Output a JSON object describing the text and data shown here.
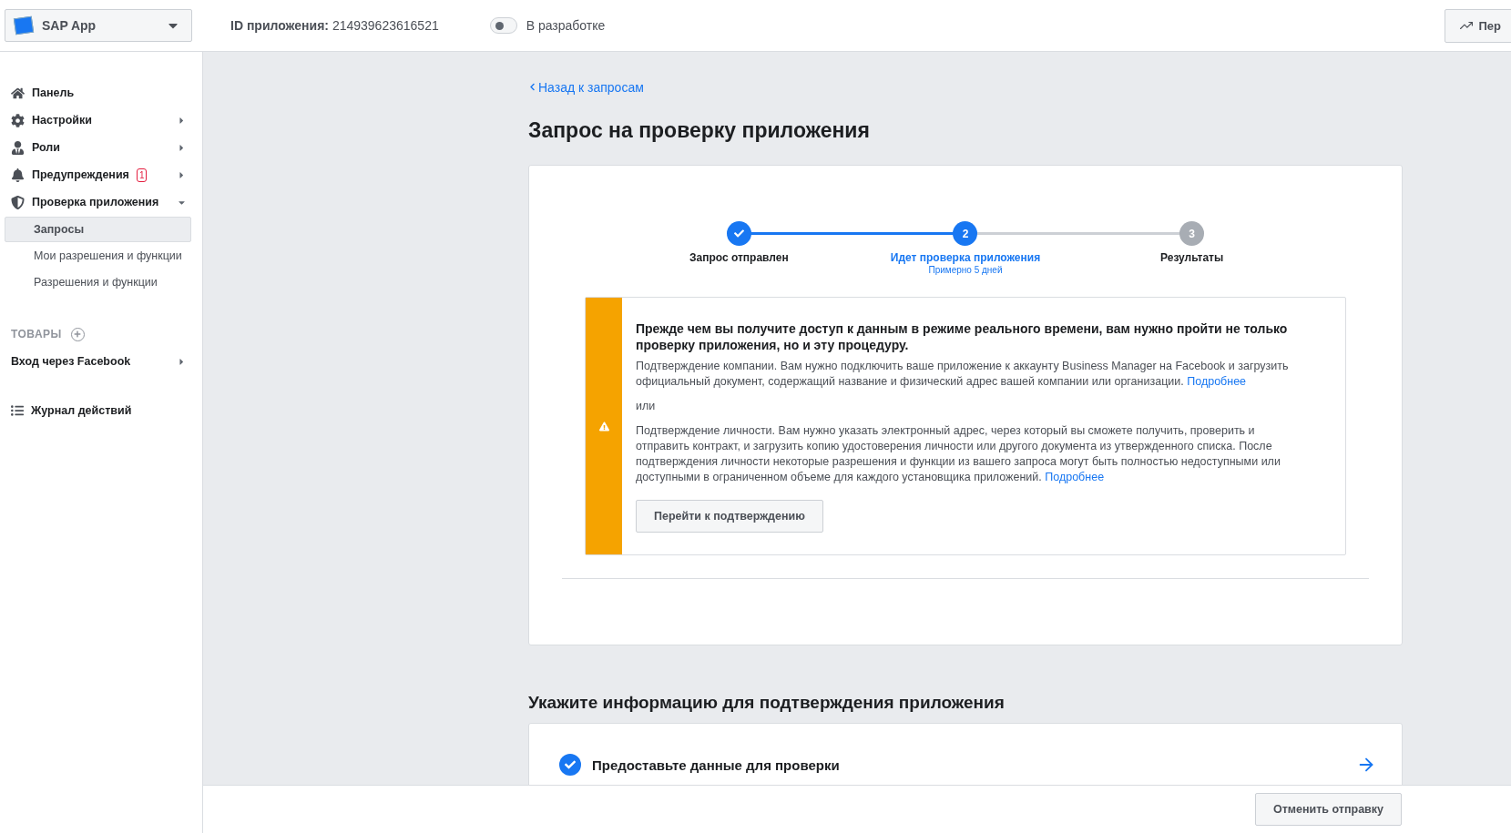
{
  "app_selector": {
    "name": "SAP App"
  },
  "header": {
    "app_id_label": "ID приложения:",
    "app_id": "214939623616521",
    "dev_mode": {
      "on": false,
      "label": "В разработке"
    },
    "right_button": "Пер"
  },
  "sidebar": {
    "items": [
      {
        "label": "Панель"
      },
      {
        "label": "Настройки",
        "expanded": false
      },
      {
        "label": "Роли",
        "expanded": false
      },
      {
        "label": "Предупреждения",
        "expanded": false,
        "badge": "1"
      },
      {
        "label": "Проверка приложения",
        "expanded": true,
        "children": [
          {
            "label": "Запросы",
            "selected": true
          },
          {
            "label": "Мои разрешения и функции",
            "selected": false
          },
          {
            "label": "Разрешения и функции",
            "selected": false
          }
        ]
      }
    ],
    "products_heading": "ТОВАРЫ",
    "products": [
      {
        "label": "Вход через Facebook"
      }
    ],
    "activity_log": "Журнал действий"
  },
  "back_link": "Назад к запросам",
  "title": "Запрос на проверку приложения",
  "steps": [
    {
      "label": "Запрос отправлен",
      "kind": "done"
    },
    {
      "label": "Идет проверка приложения",
      "number": "2",
      "sublabel": "Примерно 5 дней",
      "kind": "current"
    },
    {
      "label": "Результаты",
      "number": "3",
      "kind": "upcoming"
    }
  ],
  "warning": {
    "heading": "Прежде чем вы получите доступ к данным в режиме реального времени, вам нужно пройти не только проверку приложения, но и эту процедуру.",
    "paragraphs": [
      {
        "text": "Подтверждение компании. Вам нужно подключить ваше приложение к аккаунту Business Manager на Facebook и загрузить официальный документ, содержащий название и физический адрес вашей компании или организации.",
        "link": "Подробнее"
      },
      {
        "text": "или"
      },
      {
        "text": "Подтверждение личности. Вам нужно указать электронный адрес, через который вы сможете получить, проверить и отправить контракт, и загрузить копию удостоверения личности или другого документа из утвержденного списка. После подтверждения личности некоторые разрешения и функции из вашего запроса могут быть полностью недоступными или доступными в ограниченном объеме для каждого установщика приложений.",
        "link": "Подробнее"
      }
    ],
    "button": "Перейти к подтверждению"
  },
  "info_section": {
    "heading": "Укажите информацию для подтверждения приложения",
    "items": [
      {
        "label": "Предоставьте данные для проверки",
        "done": true
      }
    ]
  },
  "footer": {
    "cancel_button": "Отменить отправку"
  }
}
